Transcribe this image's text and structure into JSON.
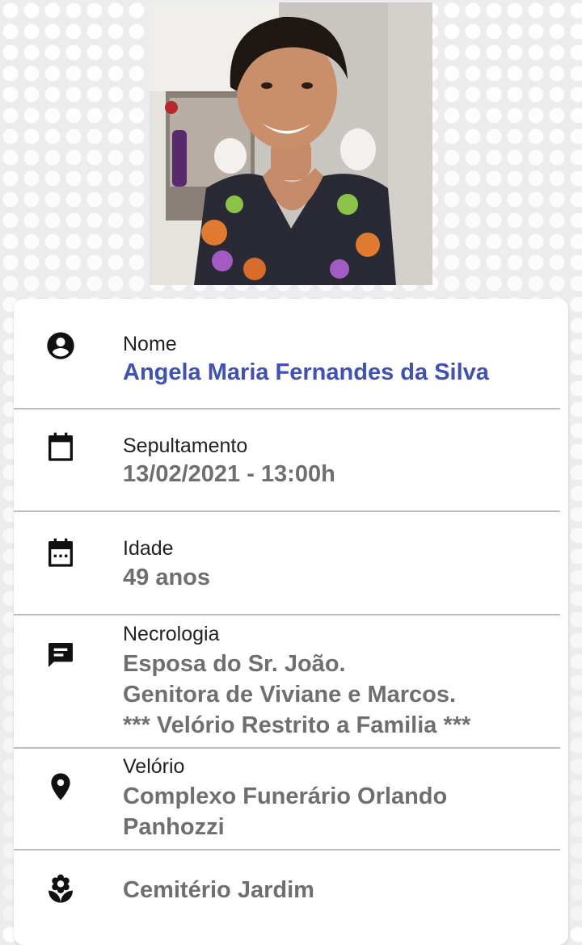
{
  "photo": {
    "alt": "Angela Maria Fernandes da Silva"
  },
  "fields": {
    "nome": {
      "label": "Nome",
      "value": "Angela Maria Fernandes da Silva",
      "icon": "account-circle-icon",
      "color": "#3f51b5"
    },
    "sepultamento": {
      "label": "Sepultamento",
      "value": "13/02/2021 - 13:00h",
      "icon": "calendar-icon"
    },
    "idade": {
      "label": "Idade",
      "value": "49 anos",
      "icon": "calendar-dots-icon"
    },
    "necrologia": {
      "label": "Necrologia",
      "lines": [
        "Esposa do Sr. João.",
        "Genitora de Viviane e Marcos.",
        "*** Velório Restrito a Familia ***"
      ],
      "icon": "message-icon"
    },
    "velorio": {
      "label": "Velório",
      "lines": [
        "Complexo Funerário Orlando",
        "Panhozzi"
      ],
      "icon": "map-pin-icon"
    },
    "cemiterio": {
      "value": "Cemitério Jardim",
      "icon": "flower-icon"
    }
  },
  "colors": {
    "accent": "#3f51b5",
    "value_gray": "#6f6f6f",
    "icon": "#111111"
  }
}
